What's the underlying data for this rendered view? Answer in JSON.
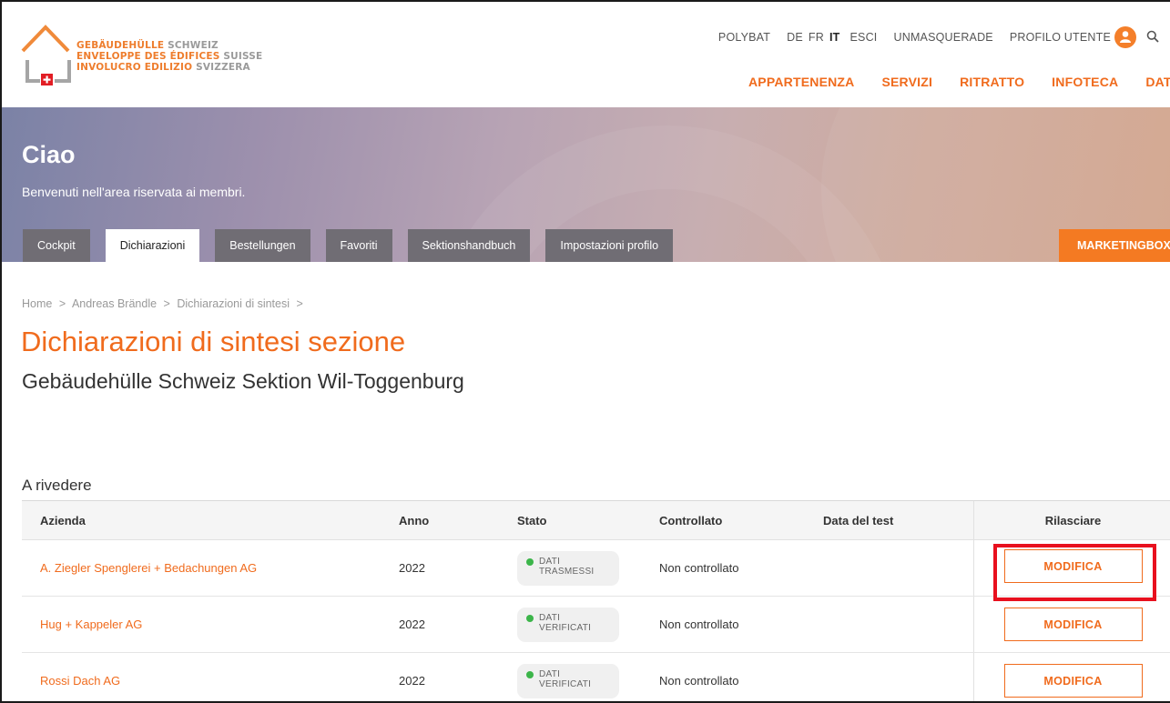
{
  "logo": {
    "line1_a": "GEBÄUDEHÜLLE",
    "line1_b": "SCHWEIZ",
    "line2_a": "ENVELOPPE DES ÉDIFICES",
    "line2_b": "SUISSE",
    "line3_a": "INVOLUCRO EDILIZIO",
    "line3_b": "SVIZZERA"
  },
  "topnav": {
    "polybat": "POLYBAT",
    "lang_de": "DE",
    "lang_fr": "FR",
    "lang_it": "IT",
    "logout": "ESCI",
    "unmasquerade": "UNMASQUERADE",
    "profile": "PROFILO UTENTE"
  },
  "mainnav": [
    "APPARTENENZA",
    "SERVIZI",
    "RITRATTO",
    "INFOTECA",
    "DATE"
  ],
  "hero": {
    "title": "Ciao",
    "subtitle": "Benvenuti nell'area riservata ai membri."
  },
  "tabs": [
    "Cockpit",
    "Dichiarazioni",
    "Bestellungen",
    "Favoriti",
    "Sektionshandbuch",
    "Impostazioni profilo"
  ],
  "tab_marketing": "MARKETINGBOX",
  "breadcrumb": [
    "Home",
    ">",
    "Andreas Brändle",
    ">",
    "Dichiarazioni di sintesi",
    ">"
  ],
  "page": {
    "title": "Dichiarazioni di sintesi sezione",
    "subtitle": "Gebäudehülle Schweiz Sektion Wil-Toggenburg",
    "section": "A rivedere"
  },
  "table": {
    "headers": [
      "Azienda",
      "Anno",
      "Stato",
      "Controllato",
      "Data del test",
      "Rilasciare"
    ],
    "rows": [
      {
        "company": "A. Ziegler Spenglerei + Bedachungen AG",
        "year": "2022",
        "status_l1": "DATI",
        "status_l2": "TRASMESSI",
        "checked": "Non controllato",
        "test_date": "",
        "action": "MODIFICA"
      },
      {
        "company": "Hug + Kappeler AG",
        "year": "2022",
        "status_l1": "DATI",
        "status_l2": "VERIFICATI",
        "checked": "Non controllato",
        "test_date": "",
        "action": "MODIFICA"
      },
      {
        "company": "Rossi Dach AG",
        "year": "2022",
        "status_l1": "DATI",
        "status_l2": "VERIFICATI",
        "checked": "Non controllato",
        "test_date": "",
        "action": "MODIFICA"
      }
    ]
  },
  "colors": {
    "brand_orange": "#f06b1d",
    "status_green": "#3cb54a",
    "highlight_red": "#e8101e"
  },
  "icons": {
    "profile": "user-icon",
    "search": "search-icon",
    "status": "status-dot-icon"
  }
}
